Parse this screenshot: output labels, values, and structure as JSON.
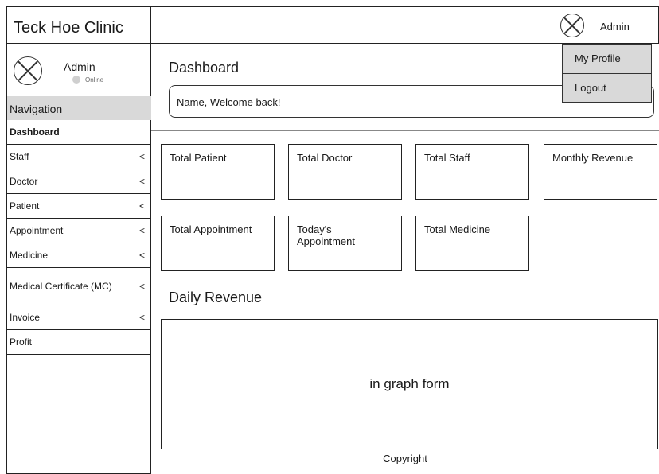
{
  "brand": {
    "name": "Teck Hoe Clinic"
  },
  "sidebar_user": {
    "name": "Admin",
    "status": "Online",
    "avatar_icon": "avatar-placeholder-icon"
  },
  "navigation": {
    "header": "Navigation",
    "items": [
      {
        "label": "Dashboard",
        "chevron": ""
      },
      {
        "label": "Staff",
        "chevron": "<"
      },
      {
        "label": "Doctor",
        "chevron": "<"
      },
      {
        "label": "Patient",
        "chevron": "<"
      },
      {
        "label": "Appointment",
        "chevron": "<"
      },
      {
        "label": "Medicine",
        "chevron": "<"
      },
      {
        "label": "Medical Certificate (MC)",
        "chevron": "<"
      },
      {
        "label": "Invoice",
        "chevron": "<"
      },
      {
        "label": "Profit",
        "chevron": ""
      }
    ]
  },
  "topbar": {
    "user": "Admin"
  },
  "user_menu": {
    "items": [
      "My Profile",
      "Logout"
    ]
  },
  "main": {
    "title": "Dashboard",
    "welcome": "Name, Welcome back!",
    "cards": [
      "Total Patient",
      "Total Doctor",
      "Total Staff",
      "Monthly Revenue",
      "Total Appointment",
      "Today's Appointment",
      "Total Medicine"
    ],
    "revenue_title": "Daily Revenue",
    "graph_placeholder": "in graph form",
    "footer": "Copyright"
  },
  "colors": {
    "highlight": "#d9d9d9",
    "border": "#222222",
    "status_dot": "#cfcfcf"
  }
}
